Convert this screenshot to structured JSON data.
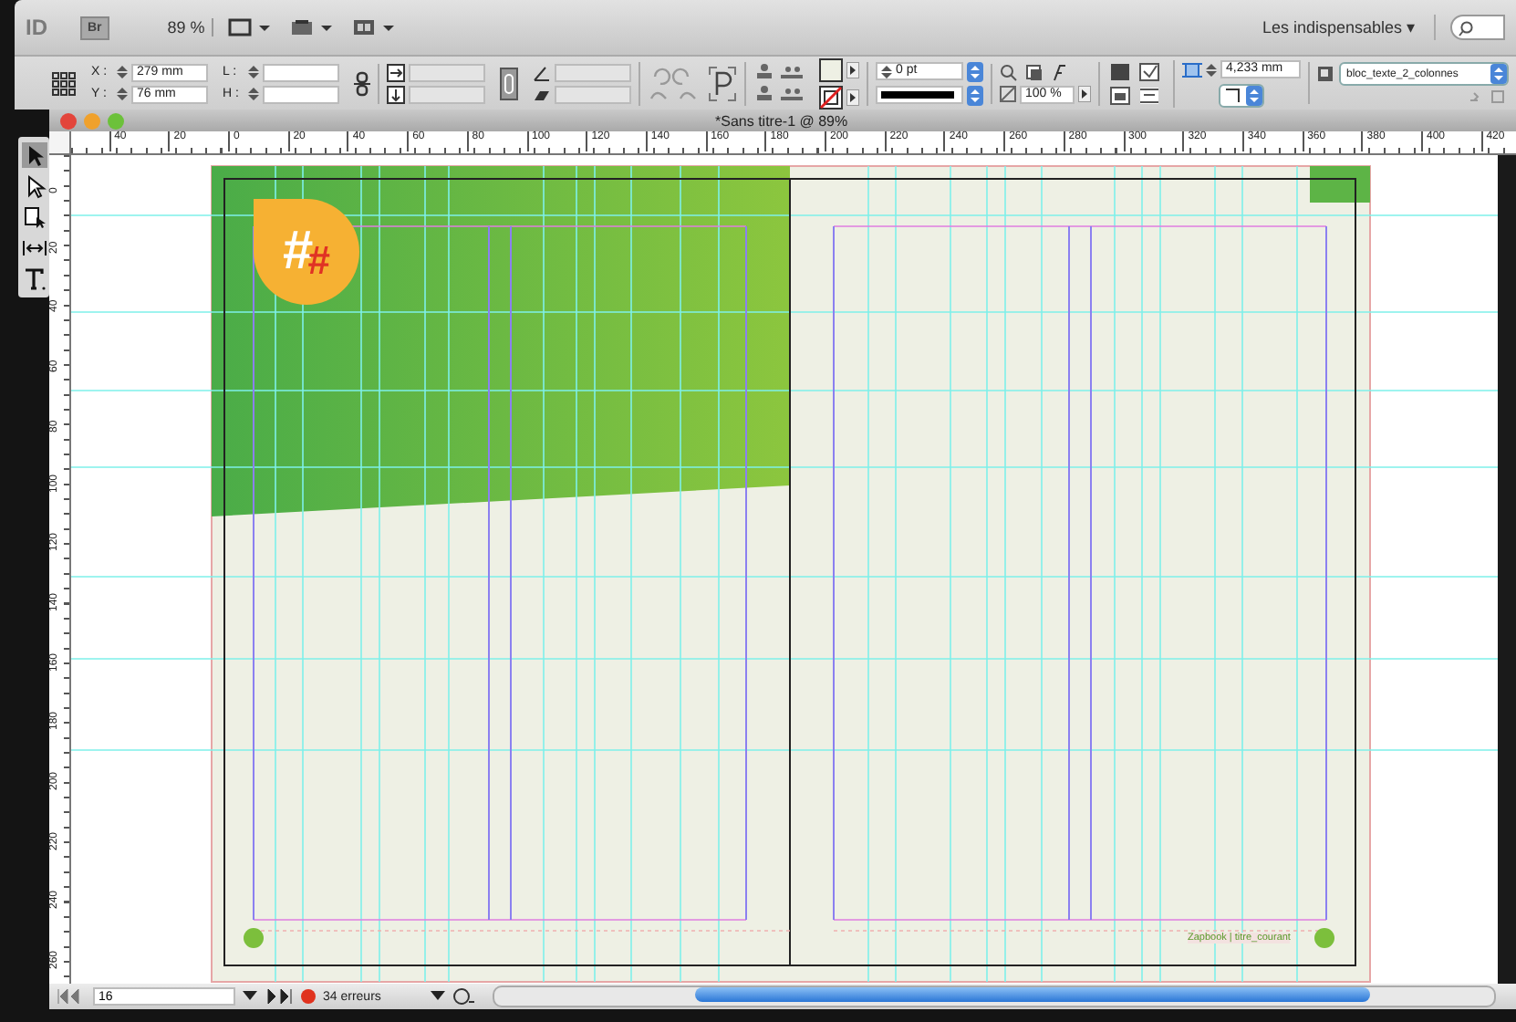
{
  "app_bar": {
    "logo": "ID",
    "bridge": "Br",
    "zoom": "89 %",
    "workspace": "Les indispensables ▾"
  },
  "control_panel": {
    "x_label": "X :",
    "x_value": "279 mm",
    "y_label": "Y :",
    "y_value": "76 mm",
    "w_label": "L :",
    "h_label": "H :",
    "stroke_weight": "0 pt",
    "opacity": "100 %",
    "column_gutter": "4,233 mm",
    "object_style": "bloc_texte_2_colonnes"
  },
  "document": {
    "title": "*Sans titre-1 @ 89%",
    "h_ruler": [
      "40",
      "20",
      "0",
      "20",
      "40",
      "60",
      "80",
      "100",
      "120",
      "140",
      "160",
      "180",
      "200",
      "220",
      "240",
      "260",
      "280",
      "300",
      "320",
      "340",
      "360",
      "380",
      "400",
      "420"
    ],
    "v_ruler": [
      "0",
      "20",
      "40",
      "60",
      "80",
      "100",
      "120",
      "140",
      "160",
      "180",
      "200",
      "220",
      "240",
      "260"
    ],
    "logo": {
      "mark": "#",
      "accent": "#"
    },
    "footer_text": "Zapbook | titre_courant"
  },
  "status_bar": {
    "page": "16",
    "errors": "34 erreurs"
  }
}
